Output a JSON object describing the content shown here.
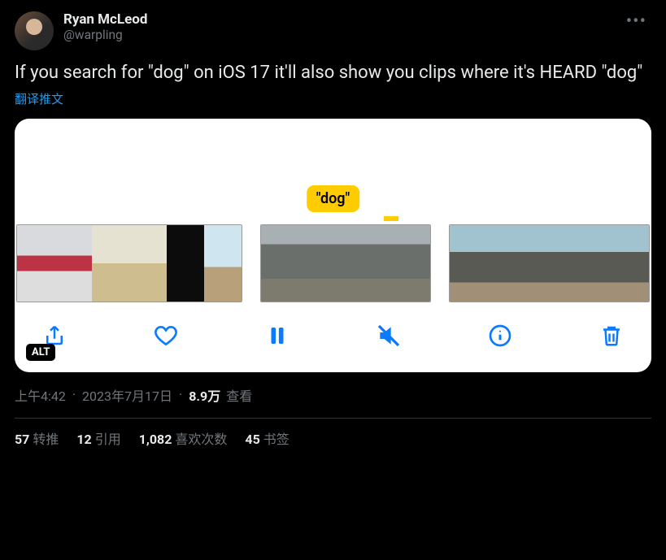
{
  "author": {
    "display_name": "Ryan McLeod",
    "handle": "@warpling"
  },
  "tweet_text": "If you search for \"dog\" on iOS 17 it'll also show you clips where it's HEARD \"dog\"",
  "translate_label": "翻译推文",
  "media": {
    "bubble_label": "\"dog\"",
    "alt_badge": "ALT"
  },
  "meta": {
    "time": "上午4:42",
    "date": "2023年7月17日",
    "views_count": "8.9万",
    "views_label": "查看"
  },
  "stats": {
    "retweets_count": "57",
    "retweets_label": "转推",
    "quotes_count": "12",
    "quotes_label": "引用",
    "likes_count": "1,082",
    "likes_label": "喜欢次数",
    "bookmarks_count": "45",
    "bookmarks_label": "书签"
  }
}
